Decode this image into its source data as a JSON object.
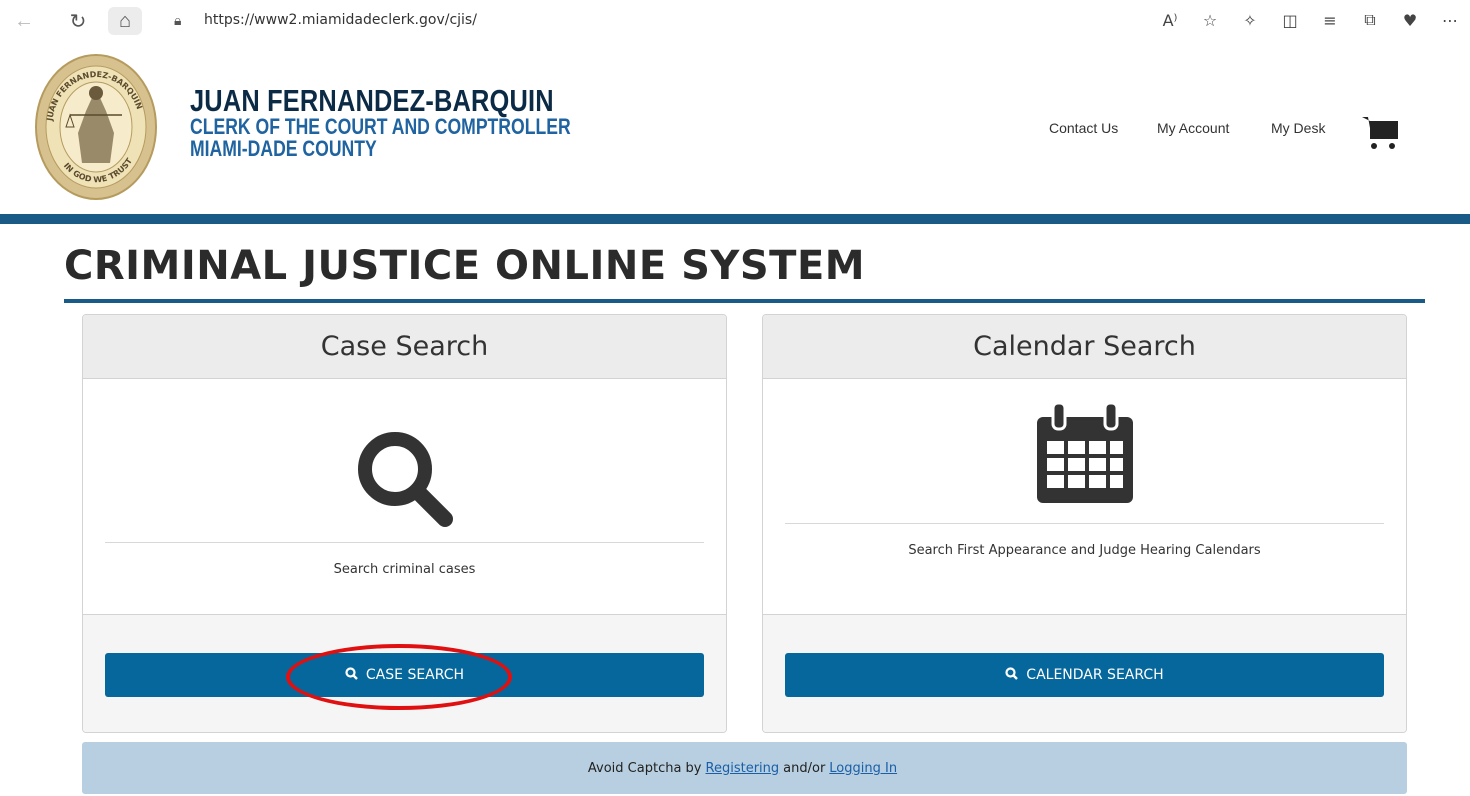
{
  "browser": {
    "url": "https://www2.miamidadeclerk.gov/cjis/",
    "read_aloud_label": "Ã"
  },
  "header": {
    "clerk_name": "JUAN FERNANDEZ-BARQUIN",
    "clerk_title": "CLERK OF THE COURT AND COMPTROLLER",
    "county": "MIAMI-DADE COUNTY",
    "seal_text_top": "JUAN FERNANDEZ-BARQUIN",
    "seal_text_bottom": "IN GOD WE TRUST",
    "nav": {
      "contact": "Contact Us",
      "account": "My Account",
      "desk": "My Desk"
    }
  },
  "page": {
    "title": "CRIMINAL JUSTICE ONLINE SYSTEM"
  },
  "case_panel": {
    "heading": "Case Search",
    "description": "Search criminal cases",
    "button_label": "CASE SEARCH",
    "icon": "search-icon"
  },
  "calendar_panel": {
    "heading": "Calendar Search",
    "description": "Search First Appearance and Judge Hearing Calendars",
    "button_label": "CALENDAR SEARCH",
    "icon": "calendar-icon"
  },
  "notice": {
    "prefix": "Avoid Captcha by",
    "register_link": "Registering",
    "middle": "and/or",
    "login_link": "Logging In"
  },
  "colors": {
    "brand_blue": "#05679b",
    "rule_blue": "#1a5a87",
    "name_navy": "#0b2a45",
    "title_blue": "#1f63a0",
    "notice_bg": "#b7cfe0",
    "highlight_red": "#e01010"
  }
}
